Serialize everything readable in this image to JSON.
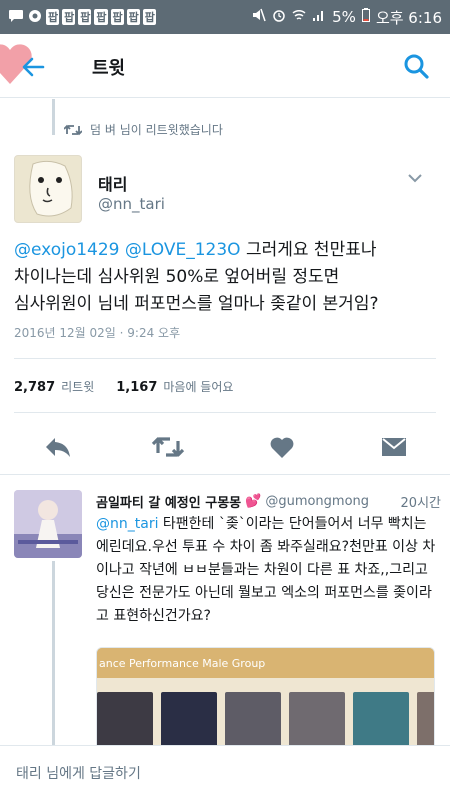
{
  "status_bar": {
    "notification_icons": [
      "chat-bubble-icon",
      "cloud-icon",
      "app-badge-icon",
      "app-badge-icon",
      "app-badge-icon",
      "app-badge-icon",
      "app-badge-icon",
      "app-badge-icon",
      "app-badge-icon"
    ],
    "badge_label": "팝",
    "battery": "5%",
    "time": "오후 6:16"
  },
  "appbar": {
    "title": "트윗"
  },
  "retweet_context": {
    "text": "덤 벼 님이 리트윗했습니다"
  },
  "tweet": {
    "name": "태리",
    "handle": "@nn_tari",
    "mention1": "@exojo1429",
    "mention2": "@LOVE_123O",
    "text_part1": " 그러게요 천만표나",
    "text_part2": "차이나는데 심사위원 50%로 엎어버릴 정도면",
    "text_part3": "심사위원이 님네 퍼포먼스를 얼마나 좆같이 본거임?",
    "timestamp": "2016년 12월 02일 · 9:24 오후",
    "retweets_count": "2,787",
    "retweets_label": "리트윗",
    "likes_count": "1,167",
    "likes_label": "마음에 들어요"
  },
  "reply": {
    "name": "곰일파티 갈 예정인 구몽몽",
    "handle": "@gumongmong",
    "time": "20시간",
    "mention": "@nn_tari",
    "text_first": " 타팬한테 `좆`이라는 단어들어서 너무 빡치는 에린데요.우선 투표 수 차이 좀 봐주실래요?천만표 이상 차이나고 작년에 ㅂㅂ분들과는 차원이 다른 표 차죠,,그리고 당신은 전문가도 아닌데 뭘보고 엑소의 퍼포먼스를 좆이라고 표현하신건가요?",
    "media_header": "ance Performance Male Group"
  },
  "composer": {
    "placeholder": "태리 님에게 답글하기"
  },
  "colors": {
    "accent": "#1b95e0",
    "status_bar": "#5d6b75",
    "like_gray": "#657786"
  }
}
